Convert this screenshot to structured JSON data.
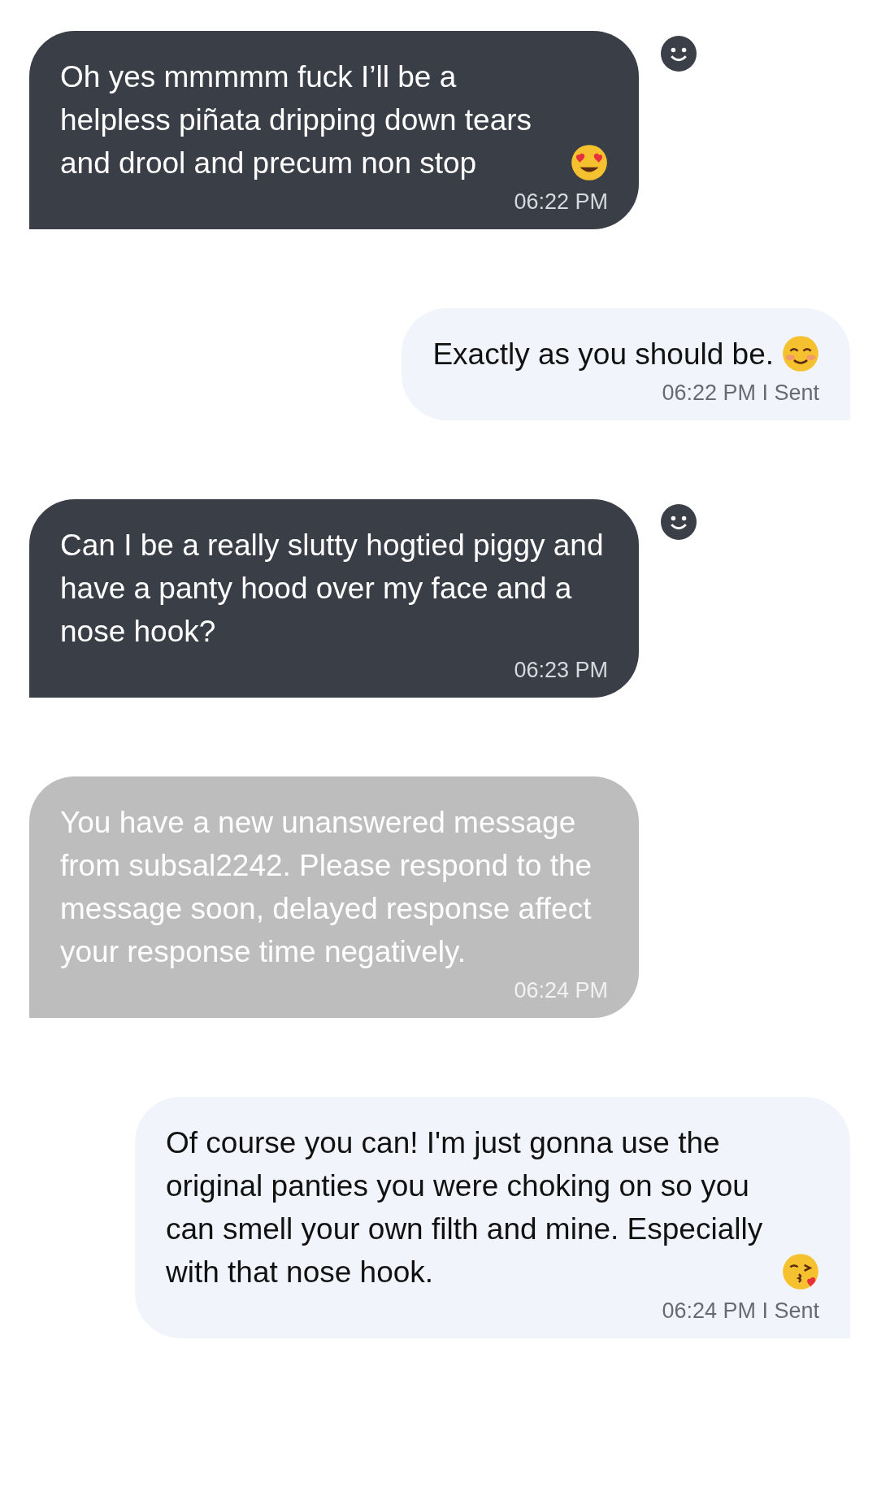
{
  "messages": [
    {
      "kind": "received",
      "text": "Oh yes mmmmm fuck I’ll be a helpless piñata dripping down tears and drool and precum non stop",
      "icon": {
        "kind": "heart_eyes"
      },
      "meta": "06:22 PM"
    },
    {
      "kind": "sent",
      "text": "Exactly as you should be.",
      "icon": {
        "kind": "blush"
      },
      "meta": "06:22 PM I Sent"
    },
    {
      "kind": "received",
      "text": "Can I be a really slutty hogtied piggy and have a panty hood over my face and a nose hook?",
      "meta": "06:23 PM"
    },
    {
      "kind": "system",
      "text": "You have a new unanswered message from subsal2242. Please respond to the message soon, delayed response affect your response time negatively.",
      "meta": "06:24 PM"
    },
    {
      "kind": "sent",
      "text": "Of course you can! I'm just gonna use the original panties you were choking on so you can smell your own filth and mine. Especially with that nose hook.",
      "icon": {
        "kind": "kiss"
      },
      "meta": "06:24 PM I Sent"
    }
  ]
}
